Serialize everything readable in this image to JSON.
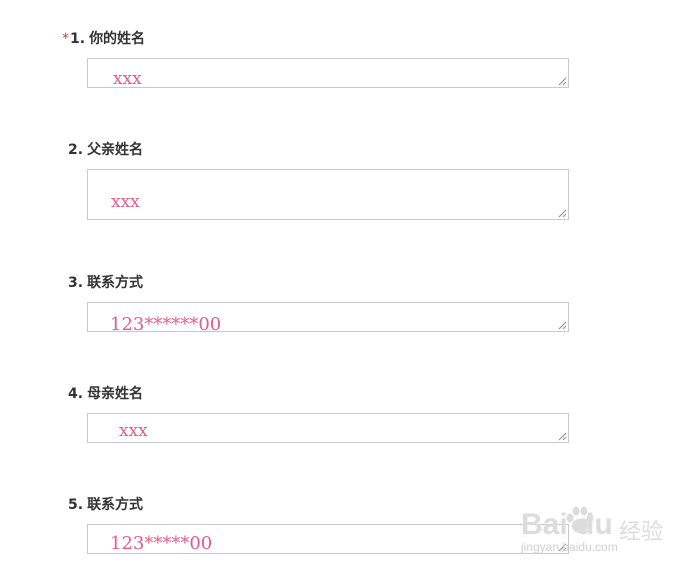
{
  "questions": [
    {
      "required_mark": "*",
      "number": "1.",
      "title": "你的姓名",
      "answer": "xxx"
    },
    {
      "required_mark": "",
      "number": "2.",
      "title": "父亲姓名",
      "answer": "xxx"
    },
    {
      "required_mark": "",
      "number": "3.",
      "title": "联系方式",
      "answer": "123******00"
    },
    {
      "required_mark": "",
      "number": "4.",
      "title": "母亲姓名",
      "answer": "xxx"
    },
    {
      "required_mark": "",
      "number": "5.",
      "title": "联系方式",
      "answer": "123*****00"
    }
  ],
  "watermark": {
    "brand": "Bai  du",
    "cn": "经验",
    "url": "jingyan.baidu.com"
  },
  "colors": {
    "required": "#e23b2e",
    "answer_text": "#e75b8a",
    "border": "#c9c9c9"
  }
}
